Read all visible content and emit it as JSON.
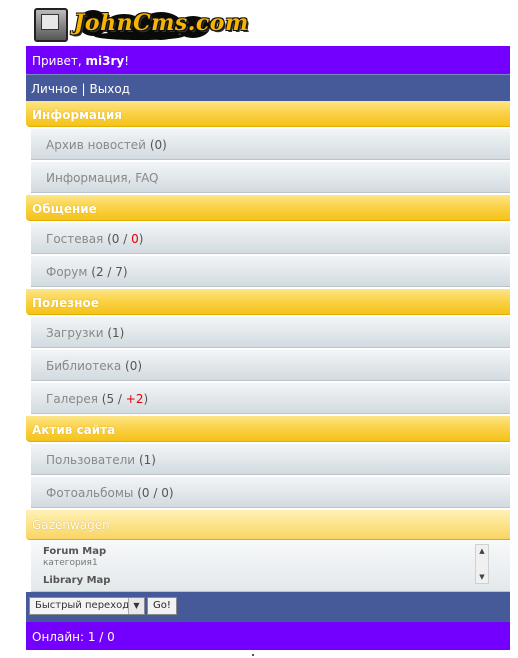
{
  "site": {
    "logo_text": "JohnCms.com"
  },
  "header": {
    "greeting_prefix": "Привет, ",
    "username": "mi3ry",
    "greeting_suffix": "!"
  },
  "nav": {
    "personal": "Личное",
    "separator": "|",
    "logout": "Выход"
  },
  "sections": [
    {
      "title": "Информация",
      "items": [
        {
          "label": "Архив новостей",
          "count": "(0)"
        },
        {
          "label": "Информация, FAQ",
          "count": ""
        }
      ]
    },
    {
      "title": "Общение",
      "items": [
        {
          "label": "Гостевая",
          "count_open": "(0 / ",
          "count_new": "0",
          "count_close": ")"
        },
        {
          "label": "Форум",
          "count": "(2 / 7)"
        }
      ]
    },
    {
      "title": "Полезное",
      "items": [
        {
          "label": "Загрузки",
          "count": "(1)"
        },
        {
          "label": "Библиотека",
          "count": "(0)"
        },
        {
          "label": "Галерея",
          "count_open": "(5 / ",
          "count_new": "+2",
          "count_close": ")"
        }
      ]
    },
    {
      "title": "Актив сайта",
      "items": [
        {
          "label": "Пользователи",
          "count": "(1)"
        },
        {
          "label": "Фотоальбомы",
          "count": "(0 / 0)"
        }
      ]
    },
    {
      "title": "Gazenwagen",
      "items": []
    }
  ],
  "list_box": {
    "entries": [
      {
        "title": "Forum Map",
        "subtitle": "категория1"
      },
      {
        "title": "Library Map",
        "subtitle": ""
      }
    ]
  },
  "quick_jump": {
    "selected": "Быстрый переход",
    "go_label": "Go!"
  },
  "footer": {
    "online": "Онлайн: 1 / 0"
  },
  "colors": {
    "purple_bar": "#7300ff",
    "blue_bar": "#465a9a",
    "section_yellow": "#fbd34a",
    "new_count_red": "#e00000"
  }
}
